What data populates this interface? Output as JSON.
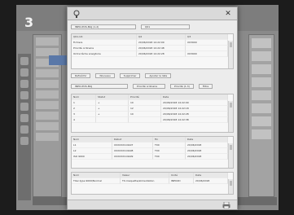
{
  "background": {
    "step_number": "3"
  },
  "dialog": {
    "field_1": "INEO-POS-MAJ (1.2)",
    "field_1b": "Q01",
    "top_table": {
      "headers": [
        "Q01-UK",
        "Q2",
        "Q3"
      ],
      "rows": [
        [
          "Fichiers",
          "20/06/2018 14:22:09",
          "X03909"
        ],
        [
          "Priorité ordinaire",
          "20/06/2018 14:22:48",
          ""
        ],
        [
          "Ordre tâche ansigtoire",
          "20/06/2018 14:22:28",
          "X03909"
        ]
      ]
    },
    "buttons_row_1": [
      "Rafraîchir",
      "Nouveau",
      "Supprimer",
      "Ajouter la liste"
    ],
    "field_2": "INEO-POS-MAJ",
    "field_2b": "Priorité ordinaire",
    "filter_label": "Priorité (1.3)",
    "filter_value": "Filtre",
    "mid_table": {
      "headers": [
        "Nom",
        "Statut",
        "Priorité",
        "Date"
      ],
      "rows": [
        [
          "1",
          "+",
          "10",
          "20/06/2018 14:22:09"
        ],
        [
          "2",
          "+",
          "12",
          "20/06/2018 14:22:18"
        ],
        [
          "3",
          "+",
          "10",
          "20/06/2018 14:22:28"
        ],
        [
          "4",
          "",
          "",
          "20/06/2018 14:22:38"
        ]
      ]
    },
    "lower_table": {
      "headers": [
        "Nom",
        "Début",
        "Fin",
        "Date"
      ],
      "rows": [
        [
          "L1",
          "XXXXXXX-NA07",
          "T00",
          "20/06/2018"
        ],
        [
          "L2",
          "XXXXXXX-NA08",
          "T00",
          "20/06/2018"
        ],
        [
          "ISO 9000",
          "XXXXXXX-NA09",
          "T00",
          "20/06/2018"
        ]
      ]
    },
    "bottom_table": {
      "headers": [
        "Nom",
        "Valeur",
        "Unité",
        "Date"
      ],
      "rows": [
        [
          "T0er-type 9000/Normal",
          "T0-maquette/alimentation",
          "INEO2D",
          "20/06/2018"
        ]
      ]
    }
  }
}
